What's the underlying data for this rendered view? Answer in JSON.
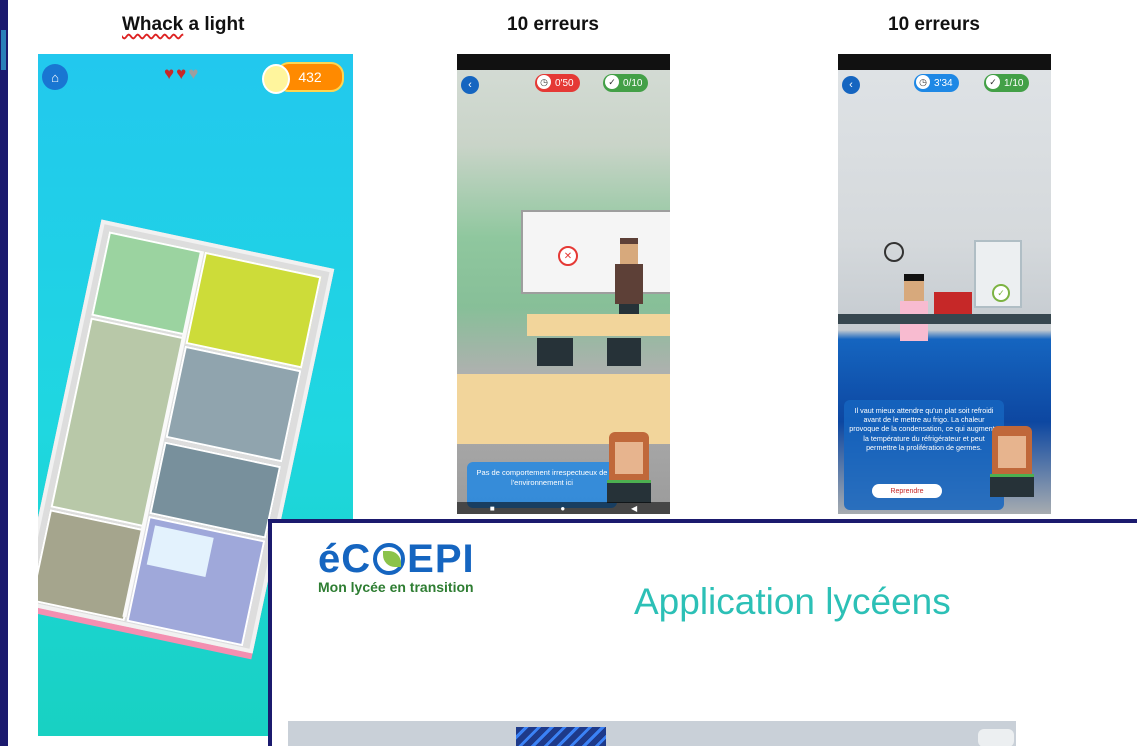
{
  "columns": {
    "col1_title_part1": "Whack",
    "col1_title_part2": " a light",
    "col2_title": "10 erreurs",
    "col3_title": "10 erreurs"
  },
  "phone1": {
    "home_icon": "home-icon",
    "lives_total": 3,
    "lives_remaining": 2,
    "score": "432"
  },
  "phone2": {
    "timer": "0'50",
    "errors_found": "0/10",
    "dialog_text": "Pas de comportement irrespectueux de l'environnement ici"
  },
  "phone3": {
    "timer": "3'34",
    "errors_found": "1/10",
    "dialog_text": "Il vaut mieux attendre qu'un plat soit refroidi avant de le mettre au frigo. La chaleur provoque de la condensation, ce qui augmente la température du réfrigérateur et peut permettre la prolifération de germes.",
    "button_label": "Reprendre"
  },
  "card": {
    "logo_prefix": "éC",
    "logo_suffix": "EPI",
    "logo_tagline": "Mon lycée en transition",
    "title": "Application lycéens"
  },
  "colors": {
    "frame_border": "#1b1a6e",
    "title_teal": "#2cc0b6",
    "logo_blue": "#1565c0",
    "tagline_green": "#2e7d32",
    "score_orange": "#ff8a00"
  }
}
